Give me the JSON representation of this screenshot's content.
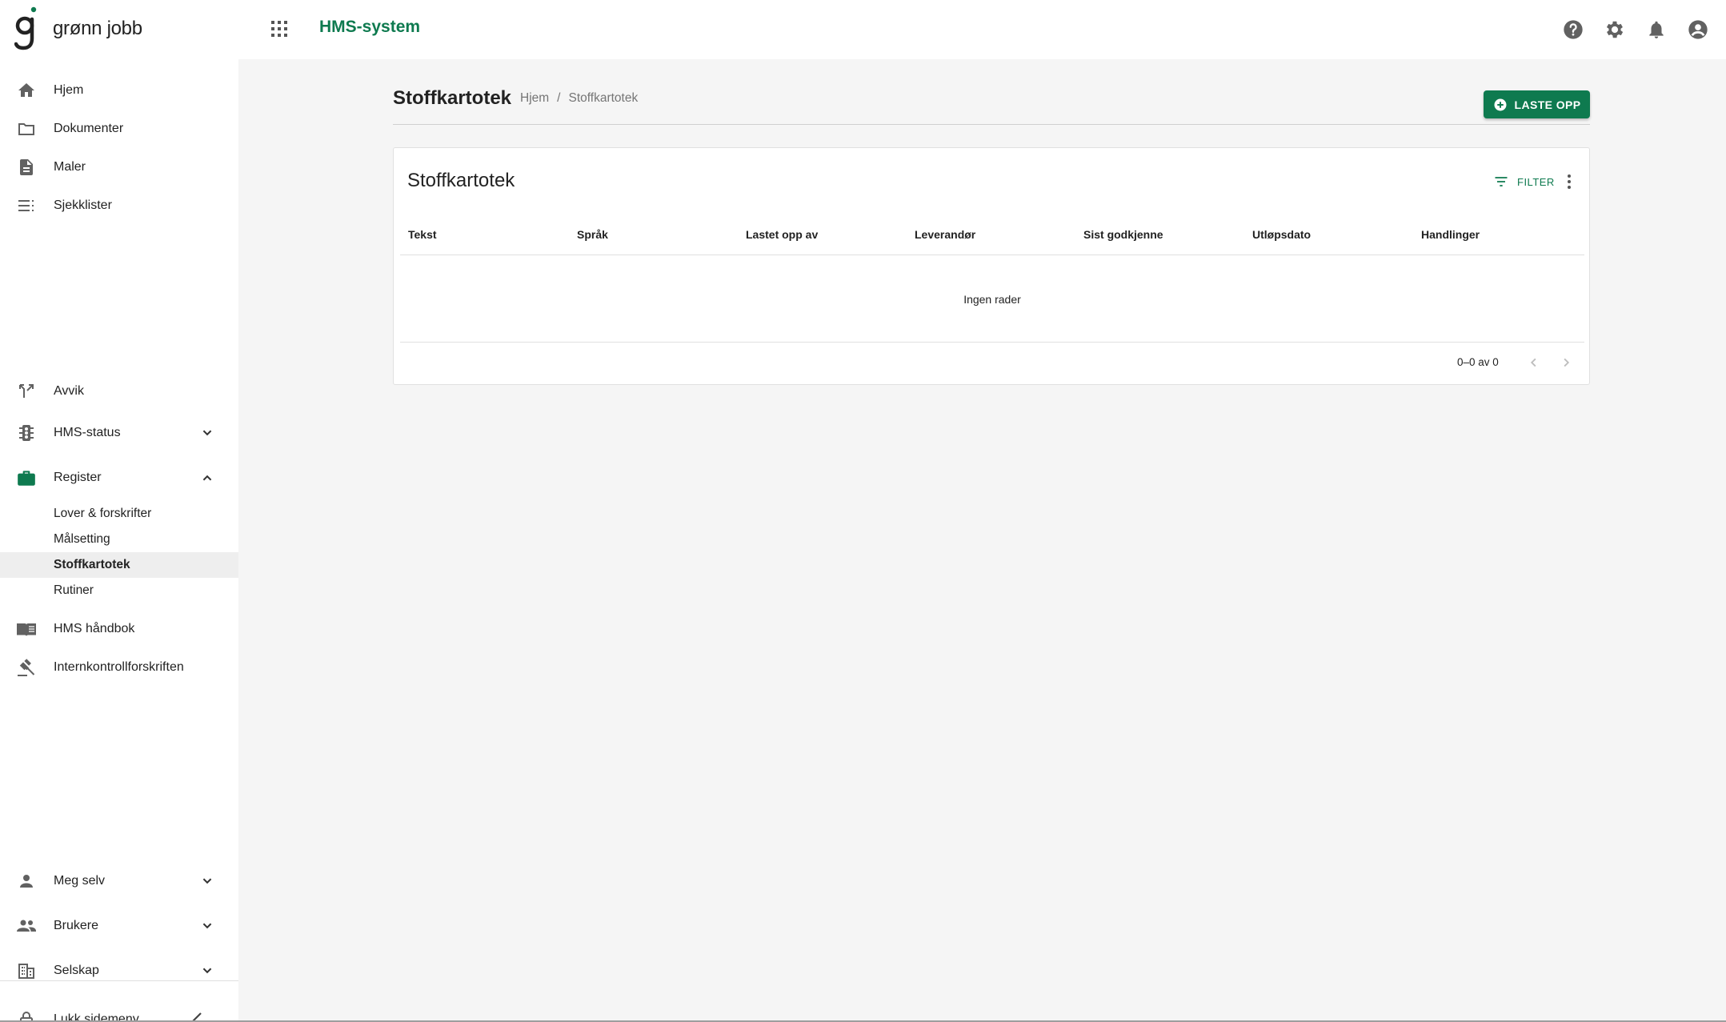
{
  "topbar": {
    "logo_text": "grønn jobb",
    "app_title": "HMS-system",
    "icons": [
      "help-icon",
      "settings-icon",
      "notifications-icon",
      "account-icon"
    ]
  },
  "sidebar": {
    "items": [
      {
        "label": "Hjem",
        "icon": "home-icon"
      },
      {
        "label": "Dokumenter",
        "icon": "folder-icon"
      },
      {
        "label": "Maler",
        "icon": "document-icon"
      },
      {
        "label": "Sjekklister",
        "icon": "checklist-icon"
      },
      {
        "label": "Avvik",
        "icon": "fork-icon"
      },
      {
        "label": "HMS-status",
        "icon": "traffic-light-icon",
        "expandable": true
      },
      {
        "label": "Register",
        "icon": "briefcase-icon",
        "expanded": true
      },
      {
        "label": "HMS håndbok",
        "icon": "book-icon"
      },
      {
        "label": "Internkontrollforskriften",
        "icon": "gavel-icon"
      },
      {
        "label": "Meg selv",
        "icon": "person-icon",
        "expandable": true
      },
      {
        "label": "Brukere",
        "icon": "people-icon",
        "expandable": true
      },
      {
        "label": "Selskap",
        "icon": "building-icon",
        "expandable": true
      }
    ],
    "register_subitems": [
      {
        "label": "Lover & forskrifter"
      },
      {
        "label": "Målsetting"
      },
      {
        "label": "Stoffkartotek",
        "active": true
      },
      {
        "label": "Rutiner"
      }
    ],
    "collapse_label": "Lukk sidemeny"
  },
  "page": {
    "title": "Stoffkartotek",
    "breadcrumb": [
      "Hjem",
      "/",
      "Stoffkartotek"
    ],
    "upload_button": "LASTE OPP"
  },
  "card": {
    "title": "Stoffkartotek",
    "filter_label": "FILTER",
    "columns": [
      "Tekst",
      "Språk",
      "Lastet opp av",
      "Leverandør",
      "Sist godkjenne",
      "Utløpsdato",
      "Handlinger"
    ],
    "empty_text": "Ingen rader",
    "pagination": "0–0 av 0"
  },
  "colors": {
    "accent": "#0e7a4f",
    "background": "#f5f5f5",
    "sidebar_active": "#eeeeee"
  }
}
